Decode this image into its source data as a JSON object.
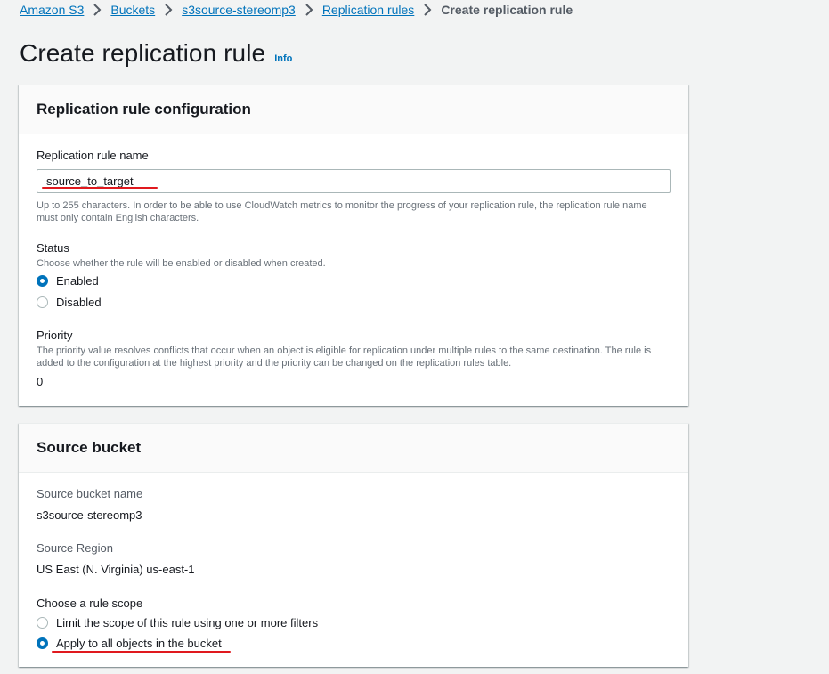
{
  "breadcrumb": {
    "items": [
      "Amazon S3",
      "Buckets",
      "s3source-stereomp3",
      "Replication rules"
    ],
    "current": "Create replication rule"
  },
  "page": {
    "title": "Create replication rule",
    "info_link": "Info"
  },
  "config_panel": {
    "title": "Replication rule configuration",
    "rule_name": {
      "label": "Replication rule name",
      "value": "source_to_target",
      "description": "Up to 255 characters. In order to be able to use CloudWatch metrics to monitor the progress of your replication rule, the replication rule name must only contain English characters."
    },
    "status": {
      "label": "Status",
      "description": "Choose whether the rule will be enabled or disabled when created.",
      "options": [
        {
          "label": "Enabled",
          "selected": true
        },
        {
          "label": "Disabled",
          "selected": false
        }
      ]
    },
    "priority": {
      "label": "Priority",
      "description": "The priority value resolves conflicts that occur when an object is eligible for replication under multiple rules to the same destination. The rule is added to the configuration at the highest priority and the priority can be changed on the replication rules table.",
      "value": "0"
    }
  },
  "source_panel": {
    "title": "Source bucket",
    "bucket_name": {
      "label": "Source bucket name",
      "value": "s3source-stereomp3"
    },
    "region": {
      "label": "Source Region",
      "value": "US East (N. Virginia) us-east-1"
    },
    "scope": {
      "label": "Choose a rule scope",
      "options": [
        {
          "label": "Limit the scope of this rule using one or more filters",
          "selected": false
        },
        {
          "label": "Apply to all objects in the bucket",
          "selected": true
        }
      ]
    }
  },
  "colors": {
    "link": "#0073bb",
    "annotation_underline": "#e0191e",
    "page_background": "#f2f3f3"
  }
}
